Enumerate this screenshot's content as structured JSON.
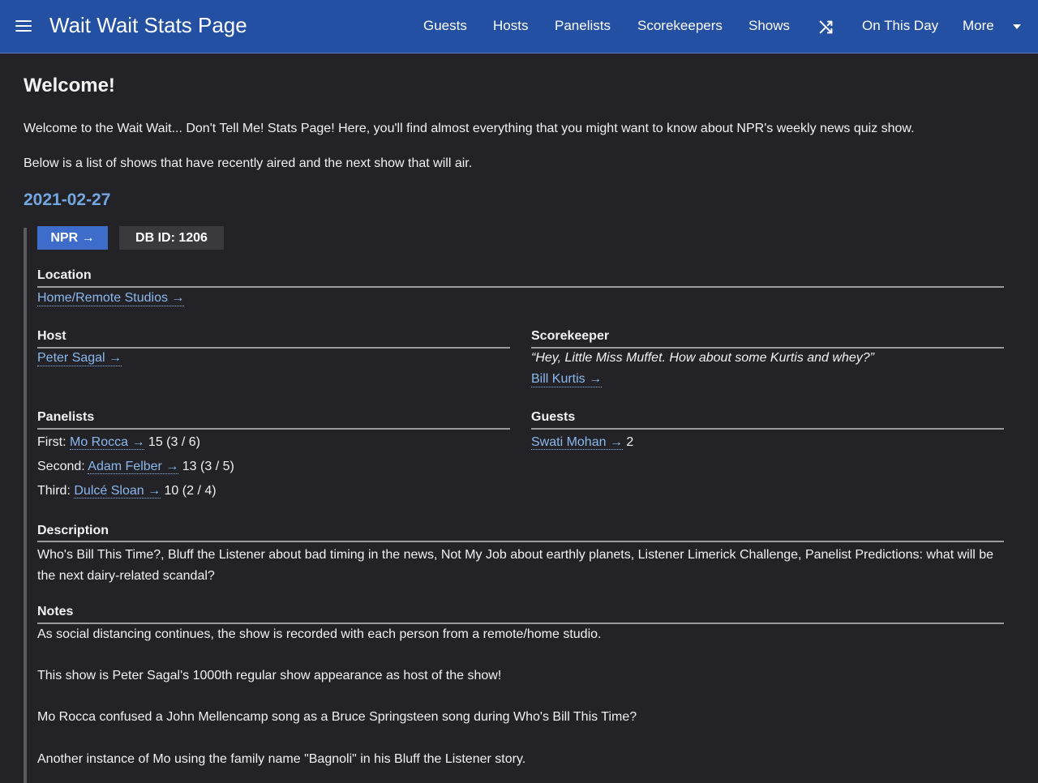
{
  "nav": {
    "brand": "Wait Wait Stats Page",
    "items": [
      "Guests",
      "Hosts",
      "Panelists",
      "Scorekeepers",
      "Shows",
      "On This Day",
      "More"
    ]
  },
  "main": {
    "welcome_title": "Welcome!",
    "intro_line1": "Welcome to the Wait Wait... Don't Tell Me! Stats Page! Here, you'll find almost everything that you might want to know about NPR's weekly news quiz show.",
    "intro_line2": "Below is a list of shows that have recently aired and the next show that will air."
  },
  "show": {
    "date": "2021-02-27",
    "npr_button": "NPR →",
    "db_id": "DB ID: 1206",
    "location": {
      "title": "Location",
      "link": "Home/Remote Studios →"
    },
    "host": {
      "title": "Host",
      "link": "Peter Sagal →"
    },
    "scorekeeper": {
      "title": "Scorekeeper",
      "quote": "“Hey, Little Miss Muffet. How about some Kurtis and whey?”",
      "link": "Bill Kurtis →"
    },
    "panelists": {
      "title": "Panelists",
      "rows": [
        {
          "label": "First:",
          "name": "Mo Rocca →",
          "score": "15 (3 / 6)"
        },
        {
          "label": "Second:",
          "name": "Adam Felber →",
          "score": "13 (3 / 5)"
        },
        {
          "label": "Third:",
          "name": "Dulcé Sloan →",
          "score": "10 (2 / 4)"
        }
      ]
    },
    "guests": {
      "title": "Guests",
      "name": "Swati Mohan →",
      "score": "2"
    },
    "description": {
      "title": "Description",
      "text": "Who's Bill This Time?, Bluff the Listener about bad timing in the news, Not My Job about earthly planets, Listener Limerick Challenge, Panelist Predictions: what will be the next dairy-related scandal?"
    },
    "notes": {
      "title": "Notes",
      "items": [
        "As social distancing continues, the show is recorded with each person from a remote/home studio.",
        "This show is Peter Sagal's 1000th regular show appearance as host of the show!",
        "Mo Rocca confused a John Mellencamp song as a Bruce Springsteen song during Who's Bill This Time?",
        "Another instance of Mo using the family name \"Bagnoli\" in his Bluff the Listener story."
      ]
    }
  }
}
